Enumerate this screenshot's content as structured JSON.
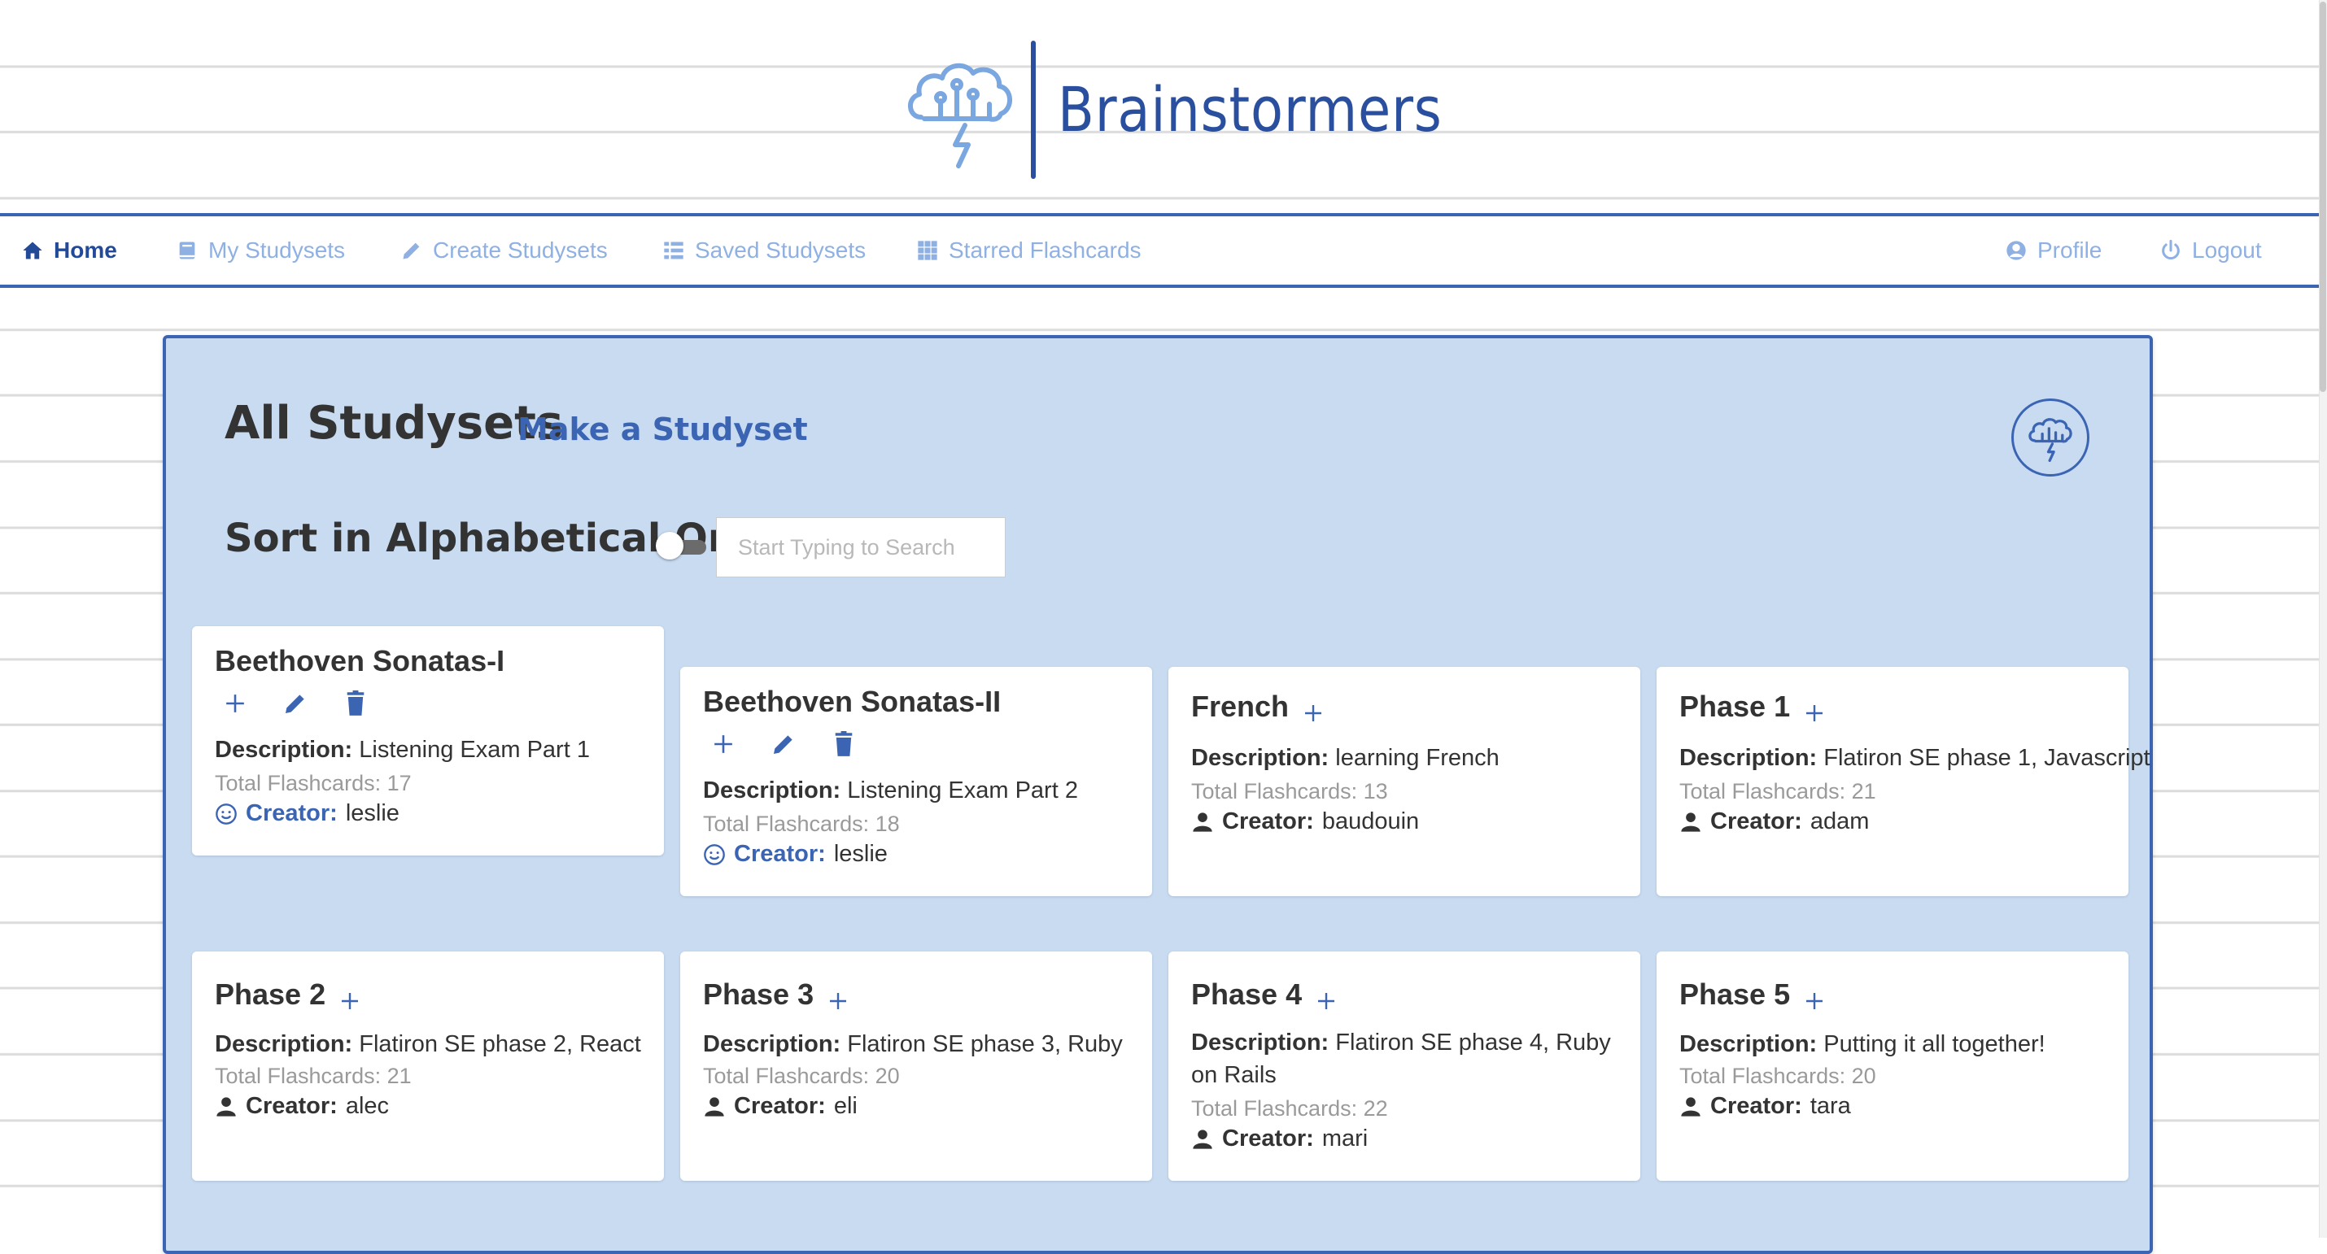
{
  "brand": {
    "name": "Brainstormers"
  },
  "nav": {
    "left": [
      {
        "label": "Home",
        "icon": "home-icon",
        "active": true
      },
      {
        "label": "My Studysets",
        "icon": "book-icon"
      },
      {
        "label": "Create Studysets",
        "icon": "pencil-icon"
      },
      {
        "label": "Saved Studysets",
        "icon": "list-icon"
      },
      {
        "label": "Starred Flashcards",
        "icon": "grid-icon"
      }
    ],
    "right": [
      {
        "label": "Profile",
        "icon": "user-circle-icon"
      },
      {
        "label": "Logout",
        "icon": "power-icon"
      }
    ]
  },
  "page": {
    "title": "All Studysets",
    "make_link": "Make a Studyset",
    "sort_label": "Sort in Alphabetical Order",
    "sort_enabled": false,
    "search_placeholder": "Start Typing to Search",
    "search_value": ""
  },
  "labels": {
    "description": "Description:",
    "total": "Total Flashcards:",
    "creator": "Creator:"
  },
  "cards": [
    {
      "title": "Beethoven Sonatas-I",
      "description": "Listening Exam Part 1",
      "total": "17",
      "creator": "leslie",
      "owned": true
    },
    {
      "title": "Beethoven Sonatas-II",
      "description": "Listening Exam Part 2",
      "total": "18",
      "creator": "leslie",
      "owned": true
    },
    {
      "title": "French",
      "description": "learning French",
      "total": "13",
      "creator": "baudouin",
      "owned": false
    },
    {
      "title": "Phase 1",
      "description": "Flatiron SE phase 1, Javascript",
      "total": "21",
      "creator": "adam",
      "owned": false
    },
    {
      "title": "Phase 2",
      "description": "Flatiron SE phase 2, React",
      "total": "21",
      "creator": "alec",
      "owned": false
    },
    {
      "title": "Phase 3",
      "description": "Flatiron SE phase 3, Ruby",
      "total": "20",
      "creator": "eli",
      "owned": false
    },
    {
      "title": "Phase 4",
      "description": "Flatiron SE phase 4, Ruby on Rails",
      "total": "22",
      "creator": "mari",
      "owned": false
    },
    {
      "title": "Phase 5",
      "description": "Putting it all together!",
      "total": "20",
      "creator": "tara",
      "owned": false
    }
  ],
  "colors": {
    "brand": "#2a4f9e",
    "accent": "#3b64b3",
    "panel": "#c8dbf1",
    "nav_inactive": "#8fb0e3"
  }
}
